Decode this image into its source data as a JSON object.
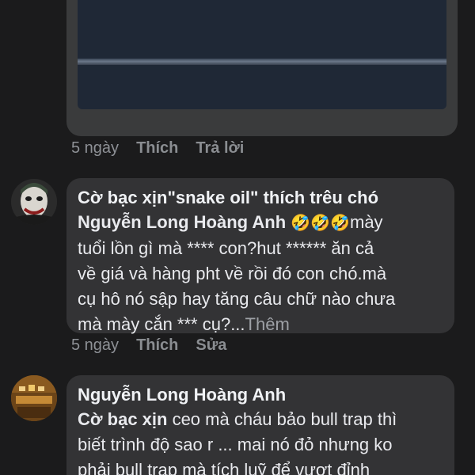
{
  "top_comment": {
    "time": "5 ngày",
    "like_label": "Thích",
    "reply_label": "Trả lời"
  },
  "comment1": {
    "author": "Cờ bạc xịn\"snake oil\" thích trêu chó",
    "mention": "Nguyễn Long Hoàng Anh",
    "emojis": "🤣🤣🤣",
    "text_line1": "mày",
    "text_line2": "tuổi lồn gì mà **** con?hut ****** ăn cả",
    "text_line3": "về giá và hàng pht  về rồi đó con chó.mà",
    "text_line4": "cụ hô nó sập hay tăng câu chữ nào chưa",
    "text_line5": "mà mày cắn *** cụ?...",
    "see_more": "Thêm",
    "time": "5 ngày",
    "like_label": "Thích",
    "edit_label": "Sửa"
  },
  "comment2": {
    "author": "Nguyễn Long Hoàng Anh",
    "mention": "Cờ bạc xịn",
    "text_line1": " ceo mà cháu bảo bull trap thì",
    "text_line2": "biết trình độ sao r ... mai nó đỏ nhưng ko",
    "text_line3": "phải bull trap mà tích luỹ để vượt đỉnh"
  },
  "colors": {
    "background": "#1b1b1c",
    "bubble": "#333335",
    "meta_text": "#8e9196"
  },
  "icons": {
    "avatar1": "joker-avatar",
    "avatar2": "room-avatar"
  }
}
